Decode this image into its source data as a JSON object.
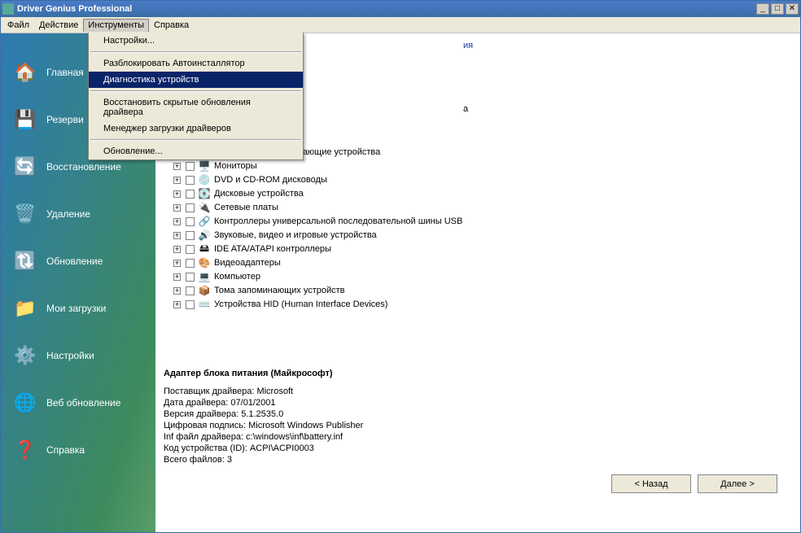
{
  "title": "Driver Genius Professional",
  "menubar": [
    "Файл",
    "Действие",
    "Инструменты",
    "Справка"
  ],
  "dropdown": {
    "items": [
      {
        "label": "Настройки..."
      },
      {
        "sep": true
      },
      {
        "label": "Разблокировать Автоинсталлятор"
      },
      {
        "label": "Диагностика устройств",
        "hl": true
      },
      {
        "sep": true
      },
      {
        "label": "Восстановить скрытые обновления драйвера"
      },
      {
        "label": "Менеджер загрузки драйверов"
      },
      {
        "sep": true
      },
      {
        "label": "Обновление..."
      }
    ]
  },
  "peek_top": "ия",
  "peek_mid": "а",
  "sidebar": {
    "items": [
      {
        "icon": "🏠",
        "label": "Главная"
      },
      {
        "icon": "💾",
        "label": "Резерви"
      },
      {
        "icon": "🔄",
        "label": "Восстановление"
      },
      {
        "icon": "🗑️",
        "label": "Удаление"
      },
      {
        "icon": "🔃",
        "label": "Обновление"
      },
      {
        "icon": "📁",
        "label": "Мои загрузки"
      },
      {
        "icon": "⚙️",
        "label": "Настройки"
      },
      {
        "icon": "🌐",
        "label": "Веб обновление"
      },
      {
        "icon": "❓",
        "label": "Справка"
      }
    ]
  },
  "tree": [
    {
      "icon": "🖱️",
      "label": "Мыши и иные указывающие устройства"
    },
    {
      "icon": "🖥️",
      "label": "Мониторы"
    },
    {
      "icon": "💿",
      "label": "DVD и CD-ROM дисководы"
    },
    {
      "icon": "💽",
      "label": "Дисковые устройства"
    },
    {
      "icon": "🔌",
      "label": "Сетевые платы"
    },
    {
      "icon": "🔗",
      "label": "Контроллеры универсальной последовательной шины USB"
    },
    {
      "icon": "🔊",
      "label": "Звуковые, видео и игровые устройства"
    },
    {
      "icon": "🖴",
      "label": "IDE ATA/ATAPI контроллеры"
    },
    {
      "icon": "🎨",
      "label": "Видеоадаптеры"
    },
    {
      "icon": "💻",
      "label": "Компьютер"
    },
    {
      "icon": "📦",
      "label": "Тома запоминающих устройств"
    },
    {
      "icon": "⌨️",
      "label": "Устройства HID (Human Interface Devices)"
    }
  ],
  "details": {
    "title": "Адаптер блока питания (Майкрософт)",
    "lines": [
      "Поставщик драйвера: Microsoft",
      "Дата драйвера: 07/01/2001",
      "Версия драйвера: 5.1.2535.0",
      "Цифровая подпись: Microsoft Windows Publisher",
      "Inf файл драйвера: c:\\windows\\inf\\battery.inf",
      "Код устройства (ID): ACPI\\ACPI0003",
      "Всего файлов: 3"
    ]
  },
  "nav": {
    "back": "< Назад",
    "next": "Далее >"
  }
}
